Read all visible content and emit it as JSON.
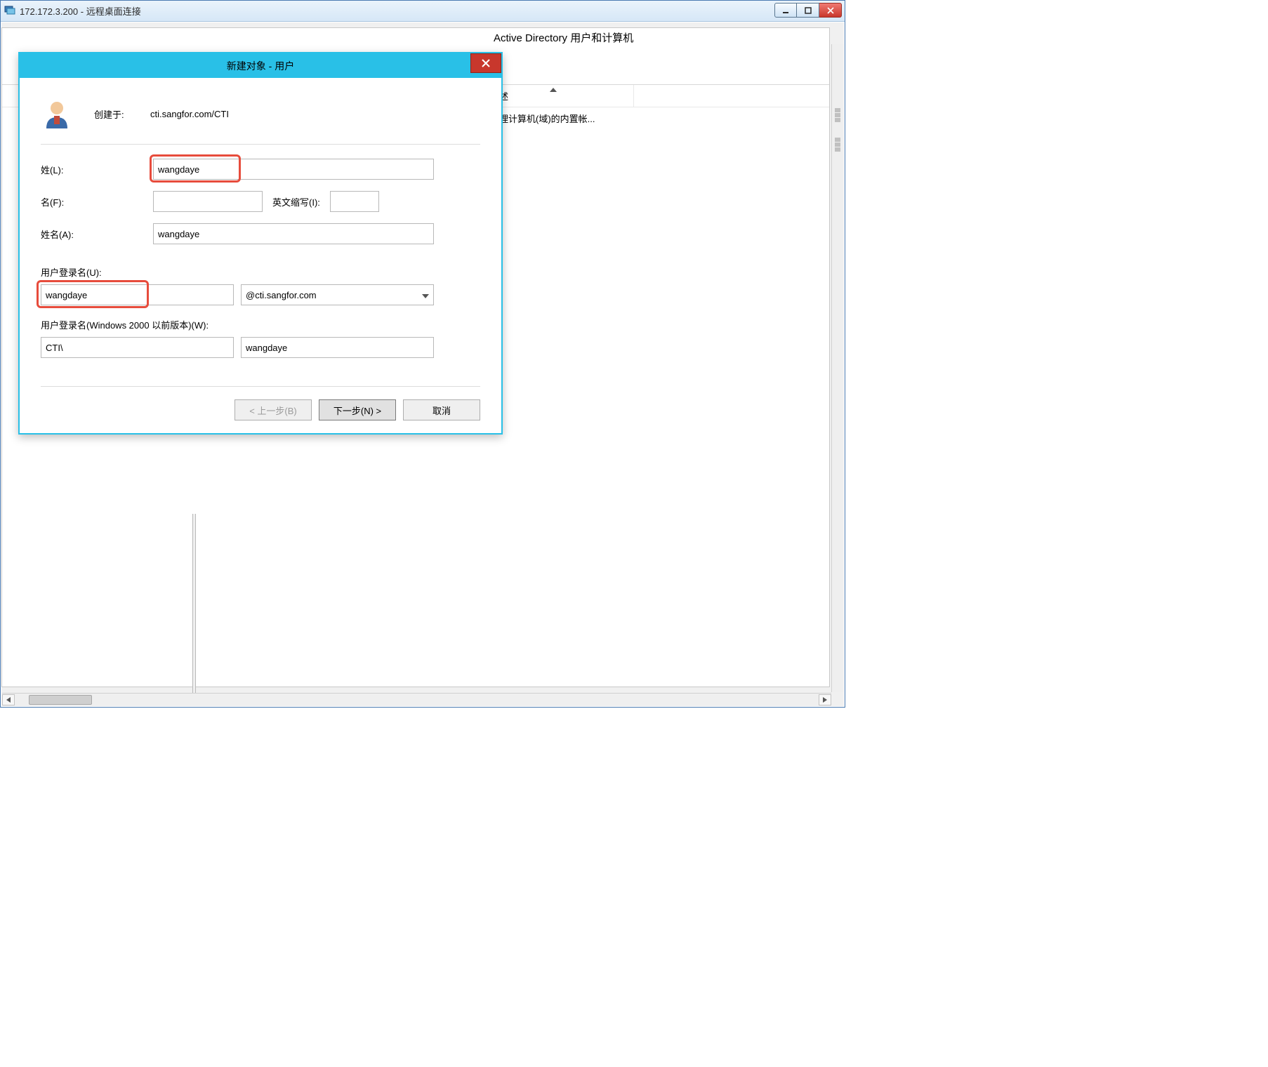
{
  "outerWindow": {
    "title": "172.172.3.200 - 远程桌面连接"
  },
  "adWindow": {
    "title": "Active Directory 用户和计算机",
    "columns": {
      "desc": "述"
    },
    "rowText": "理计算机(域)的内置帐..."
  },
  "dialog": {
    "title": "新建对象 - 用户",
    "createdInLabel": "创建于:",
    "createdInValue": "cti.sangfor.com/CTI",
    "fields": {
      "lastNameLabel": "姓(L):",
      "lastNameValue": "wangdaye",
      "firstNameLabel": "名(F):",
      "firstNameValue": "",
      "initialsLabel": "英文缩写(I):",
      "initialsValue": "",
      "fullNameLabel": "姓名(A):",
      "fullNameValue": "wangdaye",
      "logonLabel": "用户登录名(U):",
      "logonValue": "wangdaye",
      "domainValue": "@cti.sangfor.com",
      "logon2000Label": "用户登录名(Windows 2000 以前版本)(W):",
      "netbiosValue": "CTI\\",
      "logon2000Value": "wangdaye"
    },
    "buttons": {
      "back": "< 上一步(B)",
      "next": "下一步(N) >",
      "cancel": "取消"
    }
  }
}
